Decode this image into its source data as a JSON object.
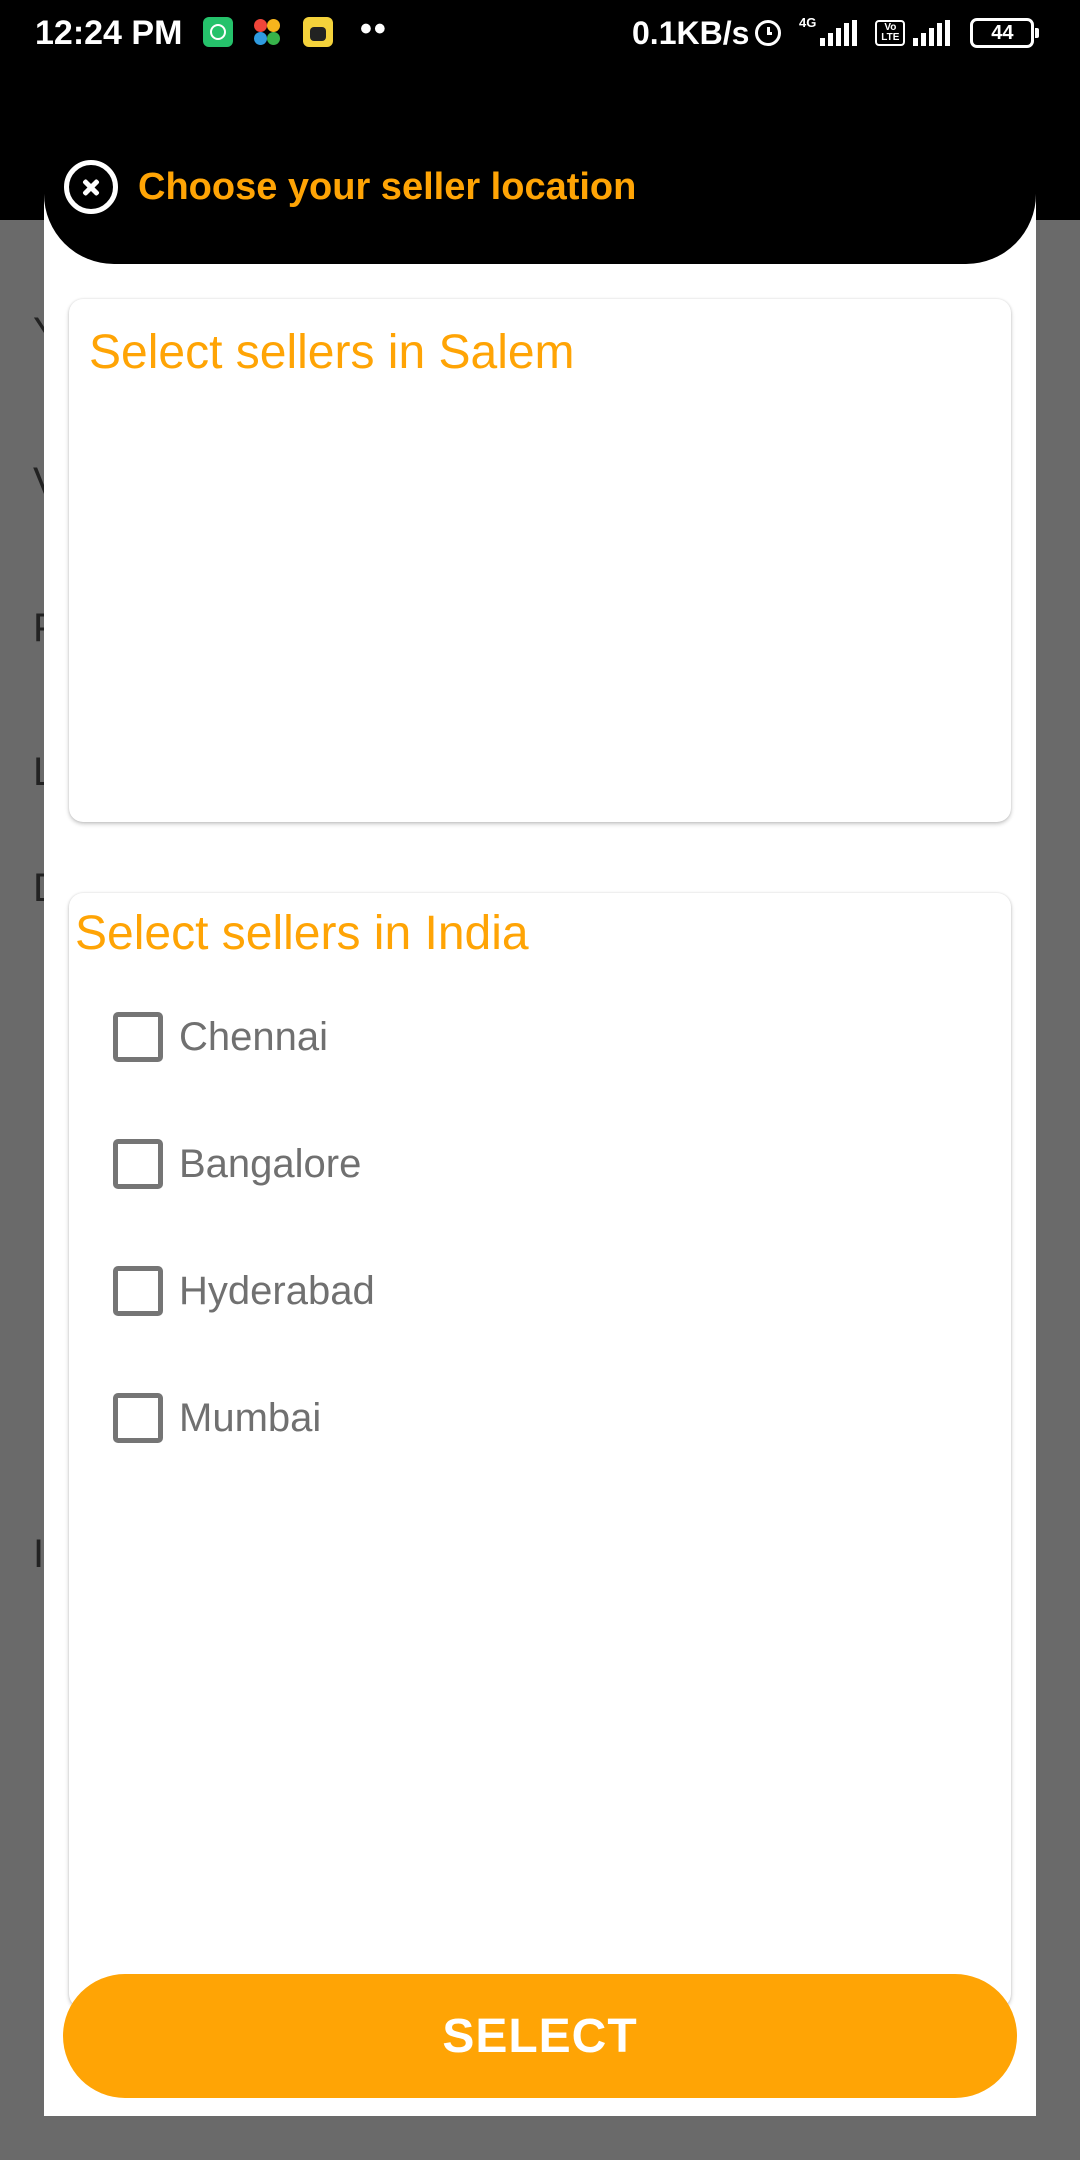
{
  "status_bar": {
    "time": "12:24 PM",
    "dots": "••",
    "network_speed": "0.1KB/s",
    "network_type": "4G",
    "volte": "Vo LTE",
    "battery": "44"
  },
  "background_screen": {
    "letters": [
      "Y",
      "V",
      "P",
      "L",
      "D",
      "I"
    ]
  },
  "dialog": {
    "title": "Choose your seller location",
    "local_section": {
      "title": "Select sellers in Salem"
    },
    "india_section": {
      "title": "Select sellers in India",
      "options": [
        {
          "label": "Chennai",
          "checked": false
        },
        {
          "label": "Bangalore",
          "checked": false
        },
        {
          "label": "Hyderabad",
          "checked": false
        },
        {
          "label": "Mumbai",
          "checked": false
        }
      ]
    },
    "select_label": "SELECT"
  },
  "colors": {
    "accent": "#ffa405",
    "header": "#000000",
    "scrim": "#6a6a6a",
    "checkbox_border": "#757575",
    "option_text": "#707070"
  }
}
